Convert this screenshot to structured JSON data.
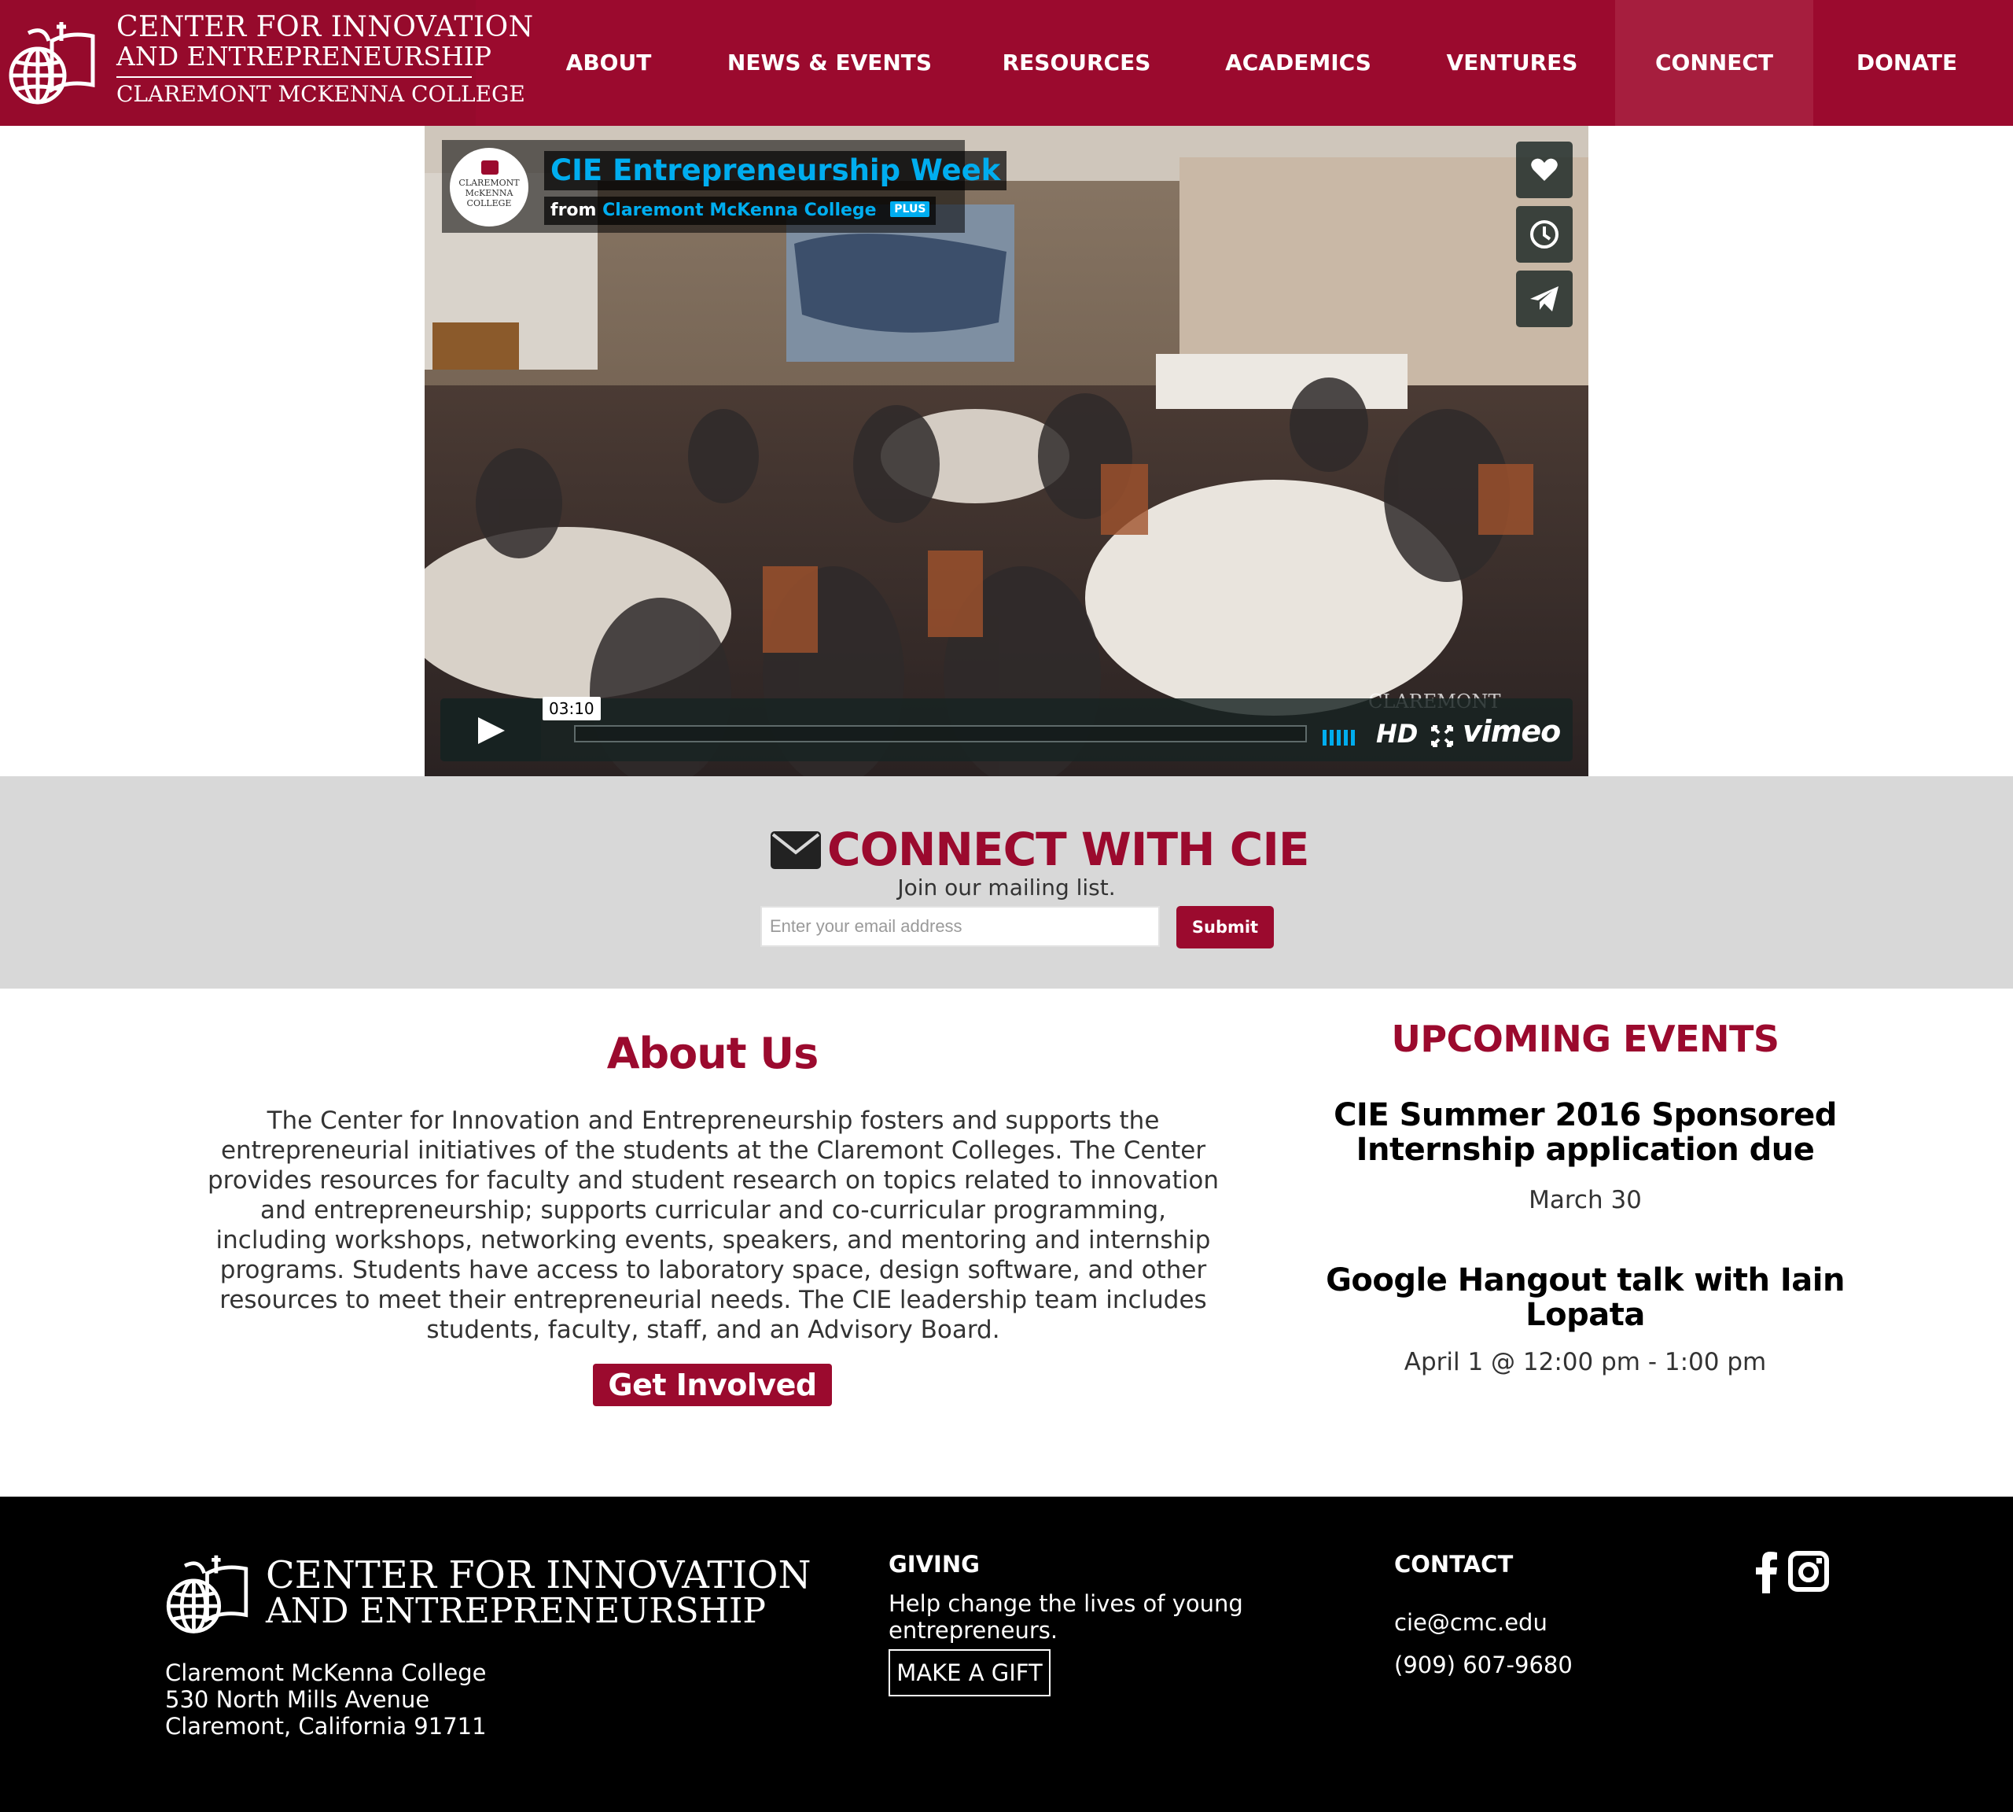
{
  "colors": {
    "brand": "#9b0a2e",
    "nav_active": "#a61e3e",
    "vimeo_blue": "#00adef",
    "band": "#d8d8d8"
  },
  "nav": {
    "logo": {
      "line1": "CENTER FOR INNOVATION",
      "line2": "AND ENTREPRENEURSHIP",
      "line3": "CLAREMONT MCKENNA COLLEGE"
    },
    "items": [
      {
        "label": "ABOUT",
        "active": false
      },
      {
        "label": "NEWS & EVENTS",
        "active": false
      },
      {
        "label": "RESOURCES",
        "active": false
      },
      {
        "label": "ACADEMICS",
        "active": false
      },
      {
        "label": "VENTURES",
        "active": false
      },
      {
        "label": "CONNECT",
        "active": true
      },
      {
        "label": "DONATE",
        "active": false
      }
    ]
  },
  "video": {
    "title": "CIE Entrepreneurship Week",
    "from_label": "from",
    "channel": "Claremont McKenna College",
    "badge": "PLUS",
    "channel_logo": "CLAREMONT McKENNA COLLEGE",
    "duration": "03:10",
    "hd_label": "HD",
    "brand": "vimeo",
    "watermark": "CLAREMONT",
    "side_buttons": [
      "heart-icon",
      "clock-icon",
      "send-icon"
    ],
    "controls": [
      "play-icon",
      "volume-icon",
      "fullscreen-icon"
    ]
  },
  "connect": {
    "icon": "envelope-icon",
    "title": "CONNECT WITH CIE",
    "subtitle": "Join our mailing list.",
    "email_placeholder": "Enter your email address",
    "submit_label": "Submit"
  },
  "about": {
    "heading": "About Us",
    "body": "The Center for Innovation and Entrepreneurship fosters and supports the entrepreneurial initiatives of the students at the Claremont Colleges. The Center provides resources for faculty and student research on topics related to innovation and entrepreneurship; supports curricular and co-curricular programming, including workshops, networking events, speakers, and mentoring and internship programs. Students have access to laboratory space, design software, and other resources to meet their entrepreneurial needs. The CIE leadership team includes students, faculty, staff, and an Advisory Board.",
    "cta": "Get Involved"
  },
  "events": {
    "heading": "UPCOMING EVENTS",
    "items": [
      {
        "title": "CIE Summer 2016 Sponsored Internship application due",
        "date": "March 30"
      },
      {
        "title": "Google Hangout talk with Iain Lopata",
        "date": "April 1 @ 12:00 pm - 1:00 pm"
      }
    ]
  },
  "footer": {
    "logo": {
      "line1": "CENTER FOR INNOVATION",
      "line2": "AND ENTREPRENEURSHIP"
    },
    "address": [
      "Claremont McKenna College",
      "530 North Mills Avenue",
      "Claremont, California 91711"
    ],
    "giving": {
      "heading": "GIVING",
      "text": [
        "Help change the lives of young",
        "entrepreneurs."
      ],
      "cta": "MAKE A GIFT"
    },
    "contact": {
      "heading": "CONTACT",
      "email": "cie@cmc.edu",
      "phone": "(909) 607-9680"
    },
    "social": [
      "facebook-icon",
      "instagram-icon"
    ]
  }
}
